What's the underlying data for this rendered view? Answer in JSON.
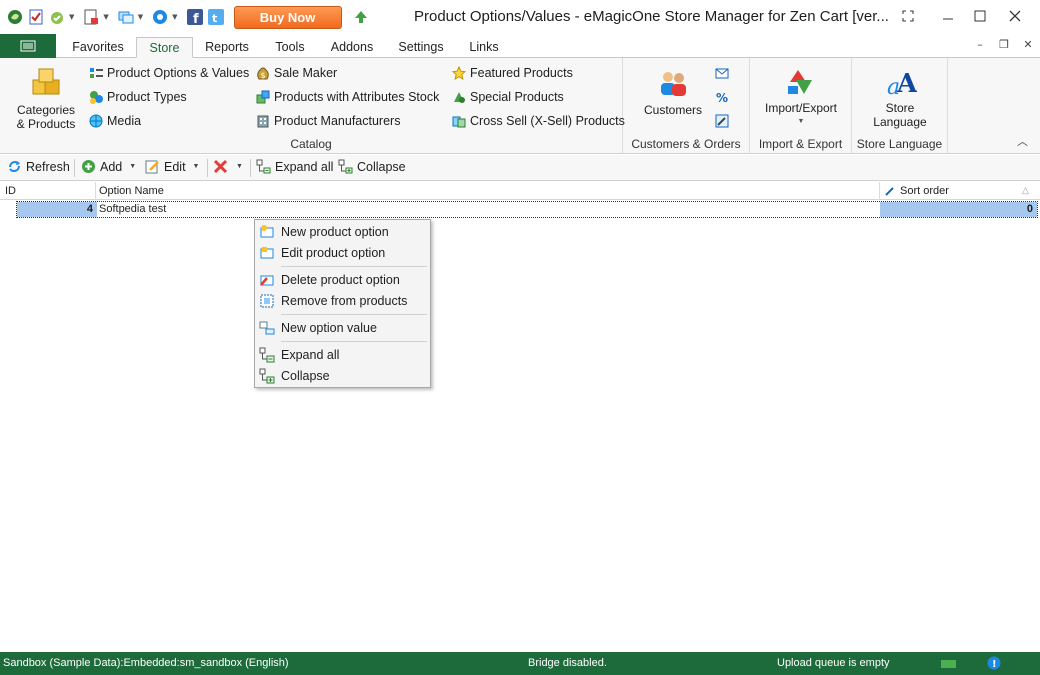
{
  "window": {
    "title": "Product Options/Values - eMagicOne Store Manager for Zen Cart [ver...",
    "buy_now": "Buy Now"
  },
  "tabs": [
    "Favorites",
    "Store",
    "Reports",
    "Tools",
    "Addons",
    "Settings",
    "Links"
  ],
  "active_tab": "Store",
  "ribbon": {
    "catalog": {
      "label": "Catalog",
      "categories_line1": "Categories",
      "categories_line2": "& Products",
      "items": [
        "Product Options & Values",
        "Product Types",
        "Media",
        "Sale Maker",
        "Products with Attributes Stock",
        "Product Manufacturers",
        "Featured Products",
        "Special Products",
        "Cross Sell (X-Sell) Products"
      ]
    },
    "customers": {
      "label": "Customers & Orders",
      "button": "Customers"
    },
    "import_export": {
      "label": "Import & Export",
      "button": "Import/Export"
    },
    "language": {
      "label": "Store Language",
      "button_line1": "Store",
      "button_line2": "Language"
    }
  },
  "toolbar": {
    "refresh": "Refresh",
    "add": "Add",
    "edit": "Edit",
    "expand_all": "Expand all",
    "collapse": "Collapse"
  },
  "grid": {
    "columns": [
      "ID",
      "Option Name",
      "Sort order"
    ],
    "rows": [
      {
        "id": "4",
        "name": "Softpedia test",
        "sort": "0"
      }
    ]
  },
  "context_menu": {
    "items": [
      "New product option",
      "Edit product option",
      "Delete product option",
      "Remove from products",
      "New option value",
      "Expand all",
      "Collapse"
    ]
  },
  "status": {
    "connection": "Sandbox (Sample Data):Embedded:sm_sandbox (English)",
    "bridge": "Bridge disabled.",
    "upload": "Upload queue is empty"
  },
  "colors": {
    "brand_green": "#1d6b3a",
    "selection": "#a6c8ef",
    "buy_now": "#f06a1e"
  }
}
